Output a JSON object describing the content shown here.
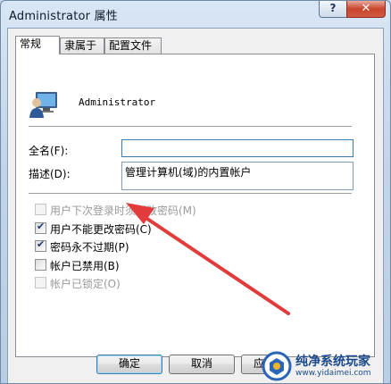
{
  "window": {
    "title": "Administrator 属性",
    "help_label": "?",
    "close_label": "✕"
  },
  "tabs": [
    {
      "label": "常规",
      "active": true
    },
    {
      "label": "隶属于",
      "active": false
    },
    {
      "label": "配置文件",
      "active": false
    }
  ],
  "user": {
    "name": "Administrator",
    "icon": "user-monitor-icon"
  },
  "form": {
    "fullname_label": "全名(F):",
    "fullname_value": "",
    "description_label": "描述(D):",
    "description_value": "管理计算机(域)的内置帐户"
  },
  "checkboxes": [
    {
      "label": "用户下次登录时须更改密码(M)",
      "checked": false,
      "disabled": true
    },
    {
      "label": "用户不能更改密码(C)",
      "checked": true,
      "disabled": false
    },
    {
      "label": "密码永不过期(P)",
      "checked": true,
      "disabled": false
    },
    {
      "label": "帐户已禁用(B)",
      "checked": false,
      "disabled": false
    },
    {
      "label": "帐户已锁定(O)",
      "checked": false,
      "disabled": true
    }
  ],
  "buttons": {
    "ok": "确定",
    "cancel": "取消",
    "apply": "应"
  },
  "watermark": {
    "title": "纯净系统玩家",
    "url": "www.yidaimei.com"
  },
  "colors": {
    "accent_arrow": "#e23b3b",
    "close_button": "#c7452c"
  }
}
